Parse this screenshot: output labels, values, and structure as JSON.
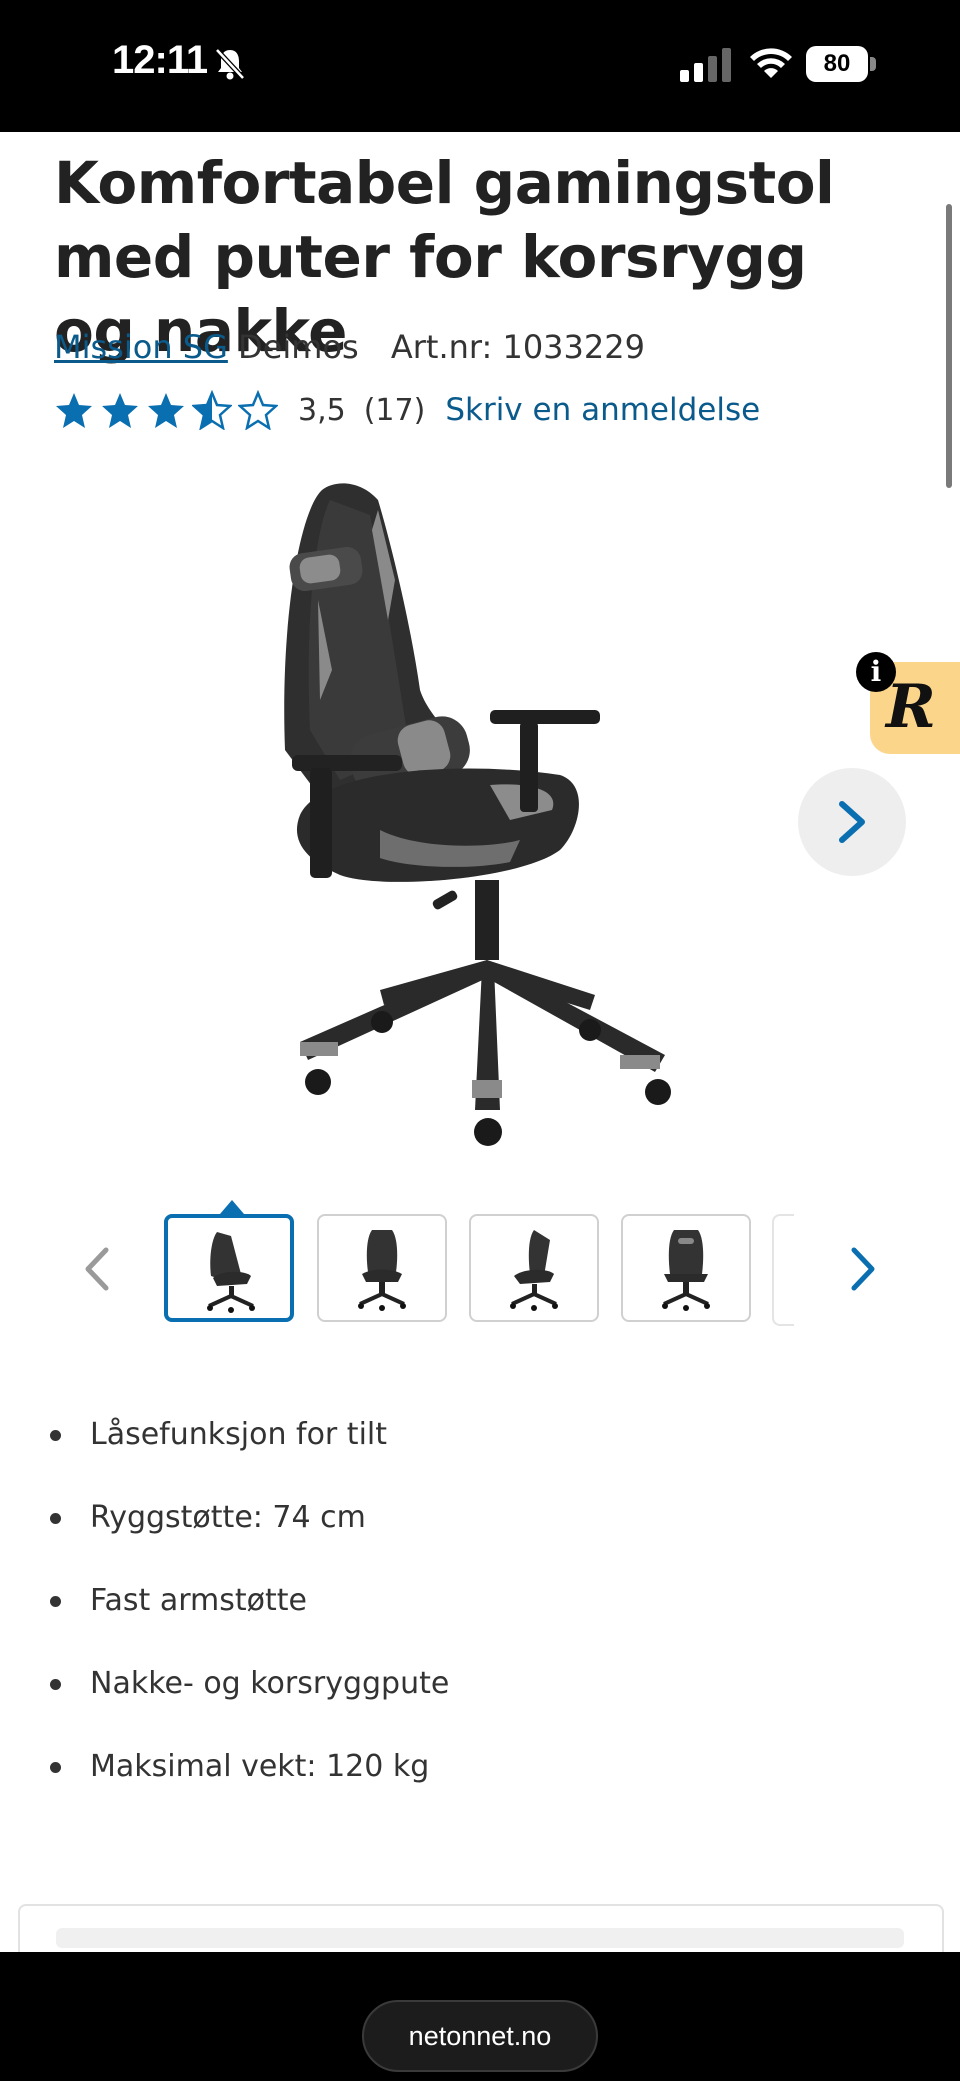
{
  "status_bar": {
    "time": "12:11",
    "battery": "80",
    "icons": [
      "bell-muted-icon",
      "cellular-signal-icon",
      "wifi-icon",
      "battery-icon"
    ]
  },
  "product": {
    "title": "Komfortabel gamingstol med puter for korsrygg og nakke",
    "brand": "Mission SG",
    "model": "Deimos",
    "article_number": "Art.nr: 1033229",
    "rating": {
      "stars_value": 3.5,
      "stars_max": 5,
      "value_text": "3,5",
      "count_text": "(17)",
      "review_link": "Skriv en anmeldelse"
    }
  },
  "gallery": {
    "main_image": "gaming-chair-photo",
    "next_icon": "chevron-right-icon",
    "thumbnails_count": 4,
    "active_thumbnail": 0
  },
  "features": [
    "Låsefunksjon for tilt",
    "Ryggstøtte: 74 cm",
    "Fast armstøtte",
    "Nakke- og korsryggpute",
    "Maksimal vekt: 120 kg"
  ],
  "widget": {
    "letter": "R",
    "info": "i"
  },
  "browser": {
    "url": "netonnet.no"
  },
  "colors": {
    "link": "#0a5a8c",
    "star": "#0a6fb0",
    "accent_border": "#0a6fb0",
    "widget_bg": "#fbd58a"
  }
}
